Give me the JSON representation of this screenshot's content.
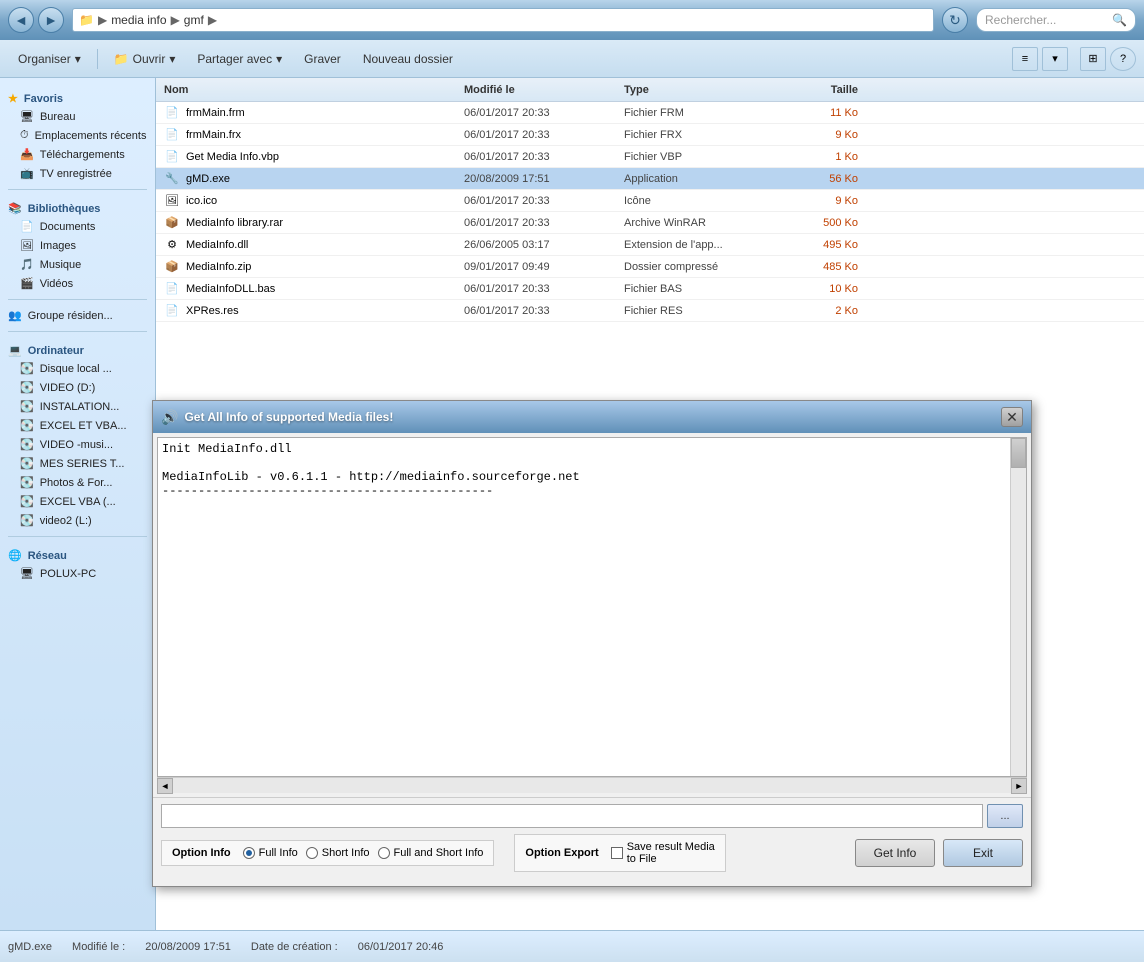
{
  "title_bar": {
    "back_label": "◄",
    "forward_label": "►",
    "address_parts": [
      "media info",
      "gmf"
    ],
    "search_placeholder": "Rechercher..."
  },
  "toolbar": {
    "organiser_label": "Organiser",
    "ouvrir_label": "Ouvrir",
    "partager_label": "Partager avec",
    "graver_label": "Graver",
    "nouveau_dossier_label": "Nouveau dossier",
    "chevron_down": "▾",
    "help_label": "?"
  },
  "columns": {
    "name": "Nom",
    "modified": "Modifié le",
    "type": "Type",
    "size": "Taille"
  },
  "files": [
    {
      "name": "frmMain.frm",
      "modified": "06/01/2017 20:33",
      "type": "Fichier FRM",
      "size": "11 Ko",
      "icon": "📄"
    },
    {
      "name": "frmMain.frx",
      "modified": "06/01/2017 20:33",
      "type": "Fichier FRX",
      "size": "9 Ko",
      "icon": "📄"
    },
    {
      "name": "Get Media Info.vbp",
      "modified": "06/01/2017 20:33",
      "type": "Fichier VBP",
      "size": "1 Ko",
      "icon": "📄"
    },
    {
      "name": "gMD.exe",
      "modified": "20/08/2009 17:51",
      "type": "Application",
      "size": "56 Ko",
      "icon": "🔧",
      "is_exe": true
    },
    {
      "name": "ico.ico",
      "modified": "06/01/2017 20:33",
      "type": "Icône",
      "size": "9 Ko",
      "icon": "🖼"
    },
    {
      "name": "MediaInfo library.rar",
      "modified": "06/01/2017 20:33",
      "type": "Archive WinRAR",
      "size": "500 Ko",
      "icon": "📦",
      "is_rar": true
    },
    {
      "name": "MediaInfo.dll",
      "modified": "26/06/2005 03:17",
      "type": "Extension de l'app...",
      "size": "495 Ko",
      "icon": "⚙"
    },
    {
      "name": "MediaInfo.zip",
      "modified": "09/01/2017 09:49",
      "type": "Dossier compressé",
      "size": "485 Ko",
      "icon": "📦",
      "is_zip": true
    },
    {
      "name": "MediaInfoDLL.bas",
      "modified": "06/01/2017 20:33",
      "type": "Fichier BAS",
      "size": "10 Ko",
      "icon": "📄"
    },
    {
      "name": "XPRes.res",
      "modified": "06/01/2017 20:33",
      "type": "Fichier RES",
      "size": "2 Ko",
      "icon": "📄"
    }
  ],
  "sidebar": {
    "favoris_label": "Favoris",
    "bureau_label": "Bureau",
    "emplacements_recents_label": "Emplacements récents",
    "telechargements_label": "Téléchargements",
    "tv_label": "TV enregistrée",
    "bibliotheques_label": "Bibliothèques",
    "documents_label": "Documents",
    "images_label": "Images",
    "musique_label": "Musique",
    "videos_label": "Vidéos",
    "groupe_label": "Groupe résiden...",
    "ordinateur_label": "Ordinateur",
    "disque_local_label": "Disque local ...",
    "video_d_label": "VIDEO (D:)",
    "instalation_label": "INSTALATION...",
    "excel_vba_label": "EXCEL ET VBA...",
    "video_music_label": "VIDEO -musi...",
    "mes_series_label": "MES SERIES T...",
    "photos_label": "Photos  & For...",
    "excel_vba2_label": "EXCEL  VBA (...",
    "video2_label": "video2 (L:)",
    "reseau_label": "Réseau",
    "polux_label": "POLUX-PC"
  },
  "dialog": {
    "title": "Get All Info of supported Media files!",
    "title_icon": "🔊",
    "close_label": "✕",
    "text_content": "Init MediaInfo.dll\n\nMediaInfoLib - v0.6.1.1 - http://mediainfo.sourceforge.net\n----------------------------------------------",
    "option_info_label": "Option Info",
    "radio_full_label": "Full Info",
    "radio_short_label": "Short Info",
    "radio_full_short_label": "Full and Short Info",
    "option_export_label": "Option Export",
    "checkbox_save_label": "Save result Media\nto File",
    "browse_label": "...",
    "btn_get_info": "Get Info",
    "btn_exit": "Exit"
  },
  "status_bar": {
    "file_name": "gMD.exe",
    "modified_label": "Modifié le :",
    "modified_date": "20/08/2009 17:51",
    "created_label": "Date de création :",
    "created_date": "06/01/2017 20:46"
  }
}
